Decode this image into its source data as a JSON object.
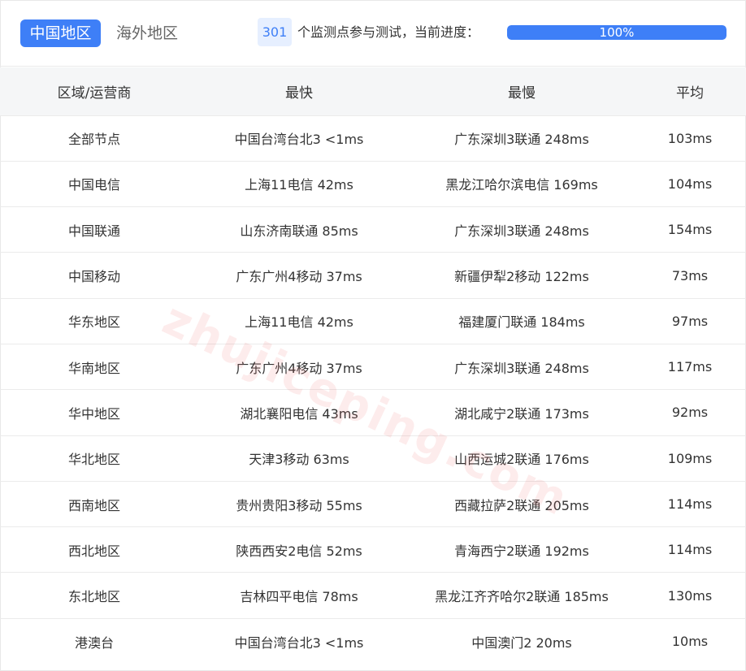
{
  "tabs": {
    "active": "中国地区",
    "inactive": "海外地区"
  },
  "progress": {
    "node_count": "301",
    "label": "个监测点参与测试，当前进度：",
    "percent_text": "100%",
    "fraction": 1.0
  },
  "table": {
    "headers": [
      "区域/运营商",
      "最快",
      "最慢",
      "平均"
    ],
    "rows": [
      [
        "全部节点",
        "中国台湾台北3 <1ms",
        "广东深圳3联通 248ms",
        "103ms"
      ],
      [
        "中国电信",
        "上海11电信 42ms",
        "黑龙江哈尔滨电信 169ms",
        "104ms"
      ],
      [
        "中国联通",
        "山东济南联通 85ms",
        "广东深圳3联通 248ms",
        "154ms"
      ],
      [
        "中国移动",
        "广东广州4移动 37ms",
        "新疆伊犁2移动 122ms",
        "73ms"
      ],
      [
        "华东地区",
        "上海11电信 42ms",
        "福建厦门联通 184ms",
        "97ms"
      ],
      [
        "华南地区",
        "广东广州4移动 37ms",
        "广东深圳3联通 248ms",
        "117ms"
      ],
      [
        "华中地区",
        "湖北襄阳电信 43ms",
        "湖北咸宁2联通 173ms",
        "92ms"
      ],
      [
        "华北地区",
        "天津3移动 63ms",
        "山西运城2联通 176ms",
        "109ms"
      ],
      [
        "西南地区",
        "贵州贵阳3移动 55ms",
        "西藏拉萨2联通 205ms",
        "114ms"
      ],
      [
        "西北地区",
        "陕西西安2电信 52ms",
        "青海西宁2联通 192ms",
        "114ms"
      ],
      [
        "东北地区",
        "吉林四平电信 78ms",
        "黑龙江齐齐哈尔2联通 185ms",
        "130ms"
      ],
      [
        "港澳台",
        "中国台湾台北3 <1ms",
        "中国澳门2 20ms",
        "10ms"
      ]
    ]
  },
  "watermark": "zhujiceping.com",
  "colors": {
    "accent": "#3e7ff7",
    "accent_light": "#e6efff",
    "header_bg": "#f5f6f7"
  }
}
